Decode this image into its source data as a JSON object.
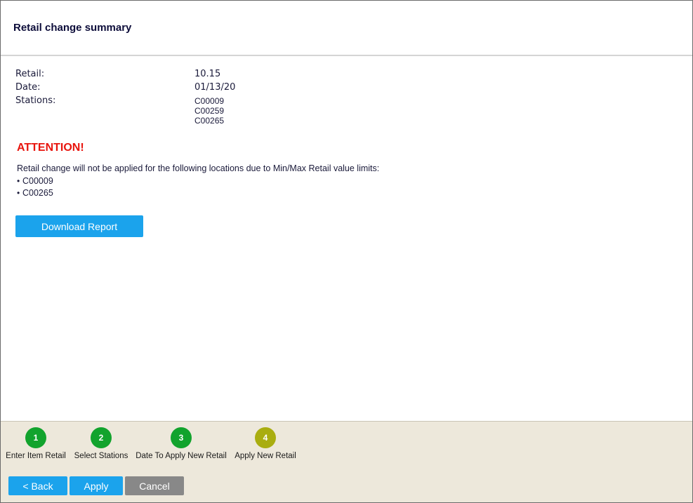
{
  "header": {
    "title": "Retail change summary"
  },
  "summary": {
    "retail_label": "Retail:",
    "retail_value": "10.15",
    "date_label": "Date:",
    "date_value": "01/13/20",
    "stations_label": "Stations:",
    "stations": [
      "C00009",
      "C00259",
      "C00265"
    ]
  },
  "warning": {
    "title": "ATTENTION!",
    "message": "Retail change will not be applied for the following locations due to Min/Max Retail value limits:",
    "locations": [
      "C00009",
      "C00265"
    ],
    "title_color": "#e8140d"
  },
  "download_button": "Download Report",
  "steps": [
    {
      "number": "1",
      "label": "Enter Item Retail",
      "state": "done"
    },
    {
      "number": "2",
      "label": "Select Stations",
      "state": "done"
    },
    {
      "number": "3",
      "label": "Date To Apply New Retail",
      "state": "done"
    },
    {
      "number": "4",
      "label": "Apply New Retail",
      "state": "current"
    }
  ],
  "footer": {
    "back_label": "< Back",
    "apply_label": "Apply",
    "cancel_label": "Cancel"
  },
  "colors": {
    "accent": "#1ba3ec",
    "step_done": "#12a32d",
    "step_current": "#a9ad10",
    "cancel": "#888888",
    "footer_bg": "#ede8db"
  }
}
